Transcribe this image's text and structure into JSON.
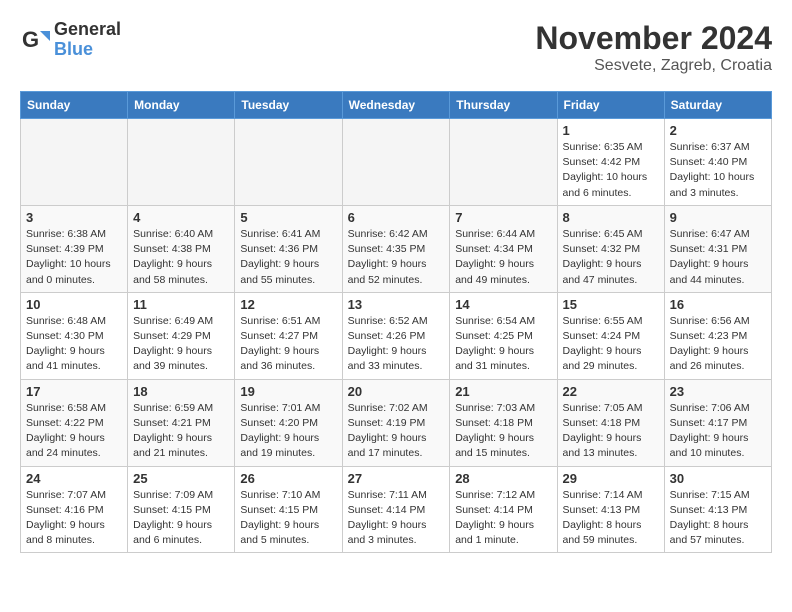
{
  "logo": {
    "line1": "General",
    "line2": "Blue"
  },
  "title": "November 2024",
  "subtitle": "Sesvete, Zagreb, Croatia",
  "days_of_week": [
    "Sunday",
    "Monday",
    "Tuesday",
    "Wednesday",
    "Thursday",
    "Friday",
    "Saturday"
  ],
  "weeks": [
    [
      {
        "day": "",
        "info": ""
      },
      {
        "day": "",
        "info": ""
      },
      {
        "day": "",
        "info": ""
      },
      {
        "day": "",
        "info": ""
      },
      {
        "day": "",
        "info": ""
      },
      {
        "day": "1",
        "info": "Sunrise: 6:35 AM\nSunset: 4:42 PM\nDaylight: 10 hours\nand 6 minutes."
      },
      {
        "day": "2",
        "info": "Sunrise: 6:37 AM\nSunset: 4:40 PM\nDaylight: 10 hours\nand 3 minutes."
      }
    ],
    [
      {
        "day": "3",
        "info": "Sunrise: 6:38 AM\nSunset: 4:39 PM\nDaylight: 10 hours\nand 0 minutes."
      },
      {
        "day": "4",
        "info": "Sunrise: 6:40 AM\nSunset: 4:38 PM\nDaylight: 9 hours\nand 58 minutes."
      },
      {
        "day": "5",
        "info": "Sunrise: 6:41 AM\nSunset: 4:36 PM\nDaylight: 9 hours\nand 55 minutes."
      },
      {
        "day": "6",
        "info": "Sunrise: 6:42 AM\nSunset: 4:35 PM\nDaylight: 9 hours\nand 52 minutes."
      },
      {
        "day": "7",
        "info": "Sunrise: 6:44 AM\nSunset: 4:34 PM\nDaylight: 9 hours\nand 49 minutes."
      },
      {
        "day": "8",
        "info": "Sunrise: 6:45 AM\nSunset: 4:32 PM\nDaylight: 9 hours\nand 47 minutes."
      },
      {
        "day": "9",
        "info": "Sunrise: 6:47 AM\nSunset: 4:31 PM\nDaylight: 9 hours\nand 44 minutes."
      }
    ],
    [
      {
        "day": "10",
        "info": "Sunrise: 6:48 AM\nSunset: 4:30 PM\nDaylight: 9 hours\nand 41 minutes."
      },
      {
        "day": "11",
        "info": "Sunrise: 6:49 AM\nSunset: 4:29 PM\nDaylight: 9 hours\nand 39 minutes."
      },
      {
        "day": "12",
        "info": "Sunrise: 6:51 AM\nSunset: 4:27 PM\nDaylight: 9 hours\nand 36 minutes."
      },
      {
        "day": "13",
        "info": "Sunrise: 6:52 AM\nSunset: 4:26 PM\nDaylight: 9 hours\nand 33 minutes."
      },
      {
        "day": "14",
        "info": "Sunrise: 6:54 AM\nSunset: 4:25 PM\nDaylight: 9 hours\nand 31 minutes."
      },
      {
        "day": "15",
        "info": "Sunrise: 6:55 AM\nSunset: 4:24 PM\nDaylight: 9 hours\nand 29 minutes."
      },
      {
        "day": "16",
        "info": "Sunrise: 6:56 AM\nSunset: 4:23 PM\nDaylight: 9 hours\nand 26 minutes."
      }
    ],
    [
      {
        "day": "17",
        "info": "Sunrise: 6:58 AM\nSunset: 4:22 PM\nDaylight: 9 hours\nand 24 minutes."
      },
      {
        "day": "18",
        "info": "Sunrise: 6:59 AM\nSunset: 4:21 PM\nDaylight: 9 hours\nand 21 minutes."
      },
      {
        "day": "19",
        "info": "Sunrise: 7:01 AM\nSunset: 4:20 PM\nDaylight: 9 hours\nand 19 minutes."
      },
      {
        "day": "20",
        "info": "Sunrise: 7:02 AM\nSunset: 4:19 PM\nDaylight: 9 hours\nand 17 minutes."
      },
      {
        "day": "21",
        "info": "Sunrise: 7:03 AM\nSunset: 4:18 PM\nDaylight: 9 hours\nand 15 minutes."
      },
      {
        "day": "22",
        "info": "Sunrise: 7:05 AM\nSunset: 4:18 PM\nDaylight: 9 hours\nand 13 minutes."
      },
      {
        "day": "23",
        "info": "Sunrise: 7:06 AM\nSunset: 4:17 PM\nDaylight: 9 hours\nand 10 minutes."
      }
    ],
    [
      {
        "day": "24",
        "info": "Sunrise: 7:07 AM\nSunset: 4:16 PM\nDaylight: 9 hours\nand 8 minutes."
      },
      {
        "day": "25",
        "info": "Sunrise: 7:09 AM\nSunset: 4:15 PM\nDaylight: 9 hours\nand 6 minutes."
      },
      {
        "day": "26",
        "info": "Sunrise: 7:10 AM\nSunset: 4:15 PM\nDaylight: 9 hours\nand 5 minutes."
      },
      {
        "day": "27",
        "info": "Sunrise: 7:11 AM\nSunset: 4:14 PM\nDaylight: 9 hours\nand 3 minutes."
      },
      {
        "day": "28",
        "info": "Sunrise: 7:12 AM\nSunset: 4:14 PM\nDaylight: 9 hours\nand 1 minute."
      },
      {
        "day": "29",
        "info": "Sunrise: 7:14 AM\nSunset: 4:13 PM\nDaylight: 8 hours\nand 59 minutes."
      },
      {
        "day": "30",
        "info": "Sunrise: 7:15 AM\nSunset: 4:13 PM\nDaylight: 8 hours\nand 57 minutes."
      }
    ]
  ]
}
